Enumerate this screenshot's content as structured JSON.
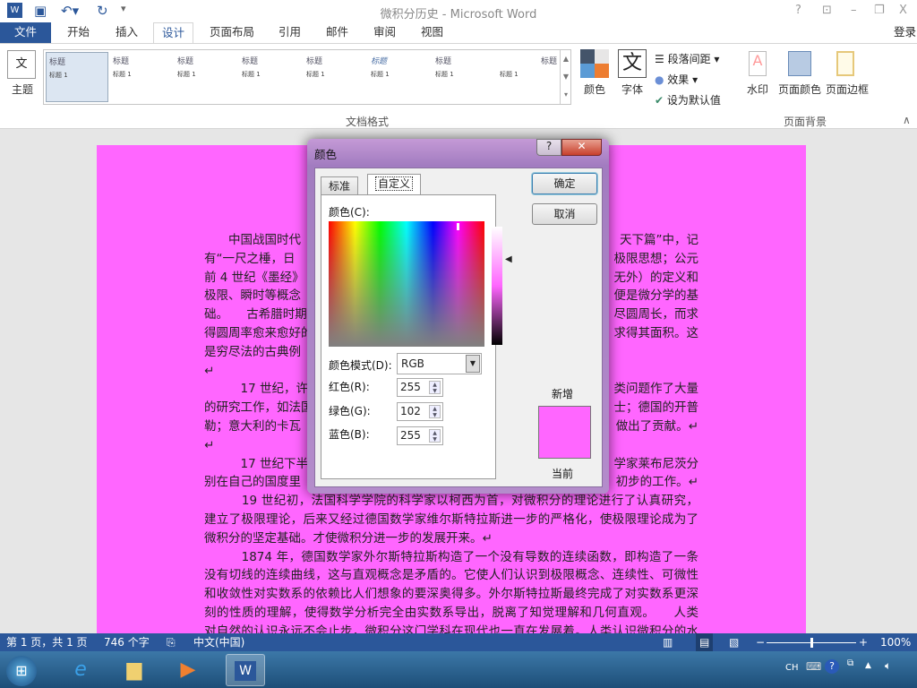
{
  "app": {
    "title": "微积分历史 - Microsoft Word",
    "signin": "登录"
  },
  "window_controls": {
    "help": "?",
    "restore_ribbon": "⊡",
    "minimize": "–",
    "maximize": "❐",
    "close": "X"
  },
  "tabs": [
    "文件",
    "开始",
    "插入",
    "设计",
    "页面布局",
    "引用",
    "邮件",
    "审阅",
    "视图"
  ],
  "active_tab": "设计",
  "ribbon": {
    "theme": "主题",
    "gallery": [
      {
        "title": "标题",
        "heading": "标题 1"
      },
      {
        "title": "标题",
        "heading": "标题 1"
      },
      {
        "title": "标题",
        "heading": "标题 1"
      },
      {
        "title": "标题",
        "heading": "标题 1"
      },
      {
        "title": "标题",
        "heading": "标题 1"
      },
      {
        "title": "标题",
        "heading": "标题 1"
      },
      {
        "title": "标题",
        "heading": "标题 1"
      },
      {
        "title": "标题",
        "heading": "标题 1"
      }
    ],
    "colors": "颜色",
    "fonts": "字体",
    "font_glyph": "文",
    "paragraph_spacing": "段落间距",
    "effects": "效果",
    "set_default": "设为默认值",
    "group_format": "文档格式",
    "watermark": "水印",
    "page_color": "页面颜色",
    "page_borders": "页面边框",
    "group_background": "页面背景"
  },
  "document": {
    "partial_lines": [
      {
        "left": "　　中国战国时代",
        "right": "天下篇”中，记"
      },
      {
        "left": "有“一尺之棰，日",
        "right": "极限思想；公元"
      },
      {
        "left": "前 4 世纪《墨经》",
        "right": "无外）的定义和"
      },
      {
        "left": "极限、瞬时等概念",
        "right": "便是微分学的基"
      },
      {
        "left": "础。　　古希腊时期",
        "right": "尽圆周长，而求"
      },
      {
        "left": "得圆周率愈来愈好的",
        "right": "求得其面积。这"
      },
      {
        "left": "是穷尽法的古典例",
        "right": ""
      },
      {
        "left": "↵",
        "right": ""
      },
      {
        "left": "　　　17 世纪，许",
        "right": "类问题作了大量"
      },
      {
        "left": "的研究工作，如法国",
        "right": "士；德国的开普"
      },
      {
        "left": "勒；意大利的卡瓦",
        "right": "做出了贡献。↵"
      },
      {
        "left": "↵",
        "right": ""
      },
      {
        "left": "　　　17 世纪下半",
        "right": "学家莱布尼茨分"
      },
      {
        "left": "别在自己的国度里",
        "right": "初步的工作。↵"
      }
    ],
    "full_lines": [
      "　　　19 世纪初，法国科学学院的科学家以柯西为首，对微积分的理论进行了认真研究，",
      "建立了极限理论，后来又经过德国数学家维尔斯特拉斯进一步的严格化，使极限理论成为了",
      "微积分的坚定基础。才使微积分进一步的发展开来。↵",
      "　　　1874 年，德国数学家外尔斯特拉斯构造了一个没有导数的连续函数，即构造了一条",
      "没有切线的连续曲线，这与直观概念是矛盾的。它使人们认识到极限概念、连续性、可微性",
      "和收敛性对实数系的依赖比人们想象的要深奥得多。外尔斯特拉斯最终完成了对实数系更深",
      "刻的性质的理解，使得数学分析完全由实数系导出，脱离了知觉理解和几何直观。　　人类",
      "对自然的认识永远不会止步，微积分这门学科在现代也一直在发展着。人类认识微积分的水"
    ],
    "page_color": "#ff66ff"
  },
  "dialog": {
    "title": "颜色",
    "help": "?",
    "close": "✕",
    "tabs": [
      "标准",
      "自定义"
    ],
    "active_tab": "自定义",
    "colors_label": "颜色(C):",
    "mode_label": "颜色模式(D):",
    "mode_value": "RGB",
    "red_label": "红色(R):",
    "red": "255",
    "green_label": "绿色(G):",
    "green": "102",
    "blue_label": "蓝色(B):",
    "blue": "255",
    "ok": "确定",
    "cancel": "取消",
    "new_label": "新增",
    "current_label": "当前",
    "new_color": "#ff66ff"
  },
  "status": {
    "page": "第 1 页，共 1 页",
    "words": "746 个字",
    "language": "中文(中国)",
    "zoom": "100%",
    "zoom_level_percent": 100
  },
  "taskbar": {
    "ime": "CH"
  }
}
